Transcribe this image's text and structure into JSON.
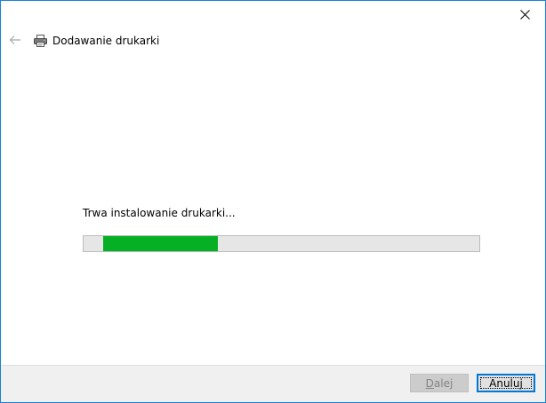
{
  "window": {
    "accent_color": "#1883d7"
  },
  "header": {
    "title": "Dodawanie drukarki",
    "back_icon": "back-arrow-icon",
    "title_icon": "printer-icon",
    "close_icon": "close-icon"
  },
  "main": {
    "status_text": "Trwa instalowanie drukarki...",
    "progress": {
      "segment_start": 0.05,
      "segment_end": 0.34,
      "fill_color": "#06b025"
    }
  },
  "footer": {
    "next_label_pre": "",
    "next_label_accel": "D",
    "next_label_post": "alej",
    "cancel_label": "Anuluj"
  }
}
